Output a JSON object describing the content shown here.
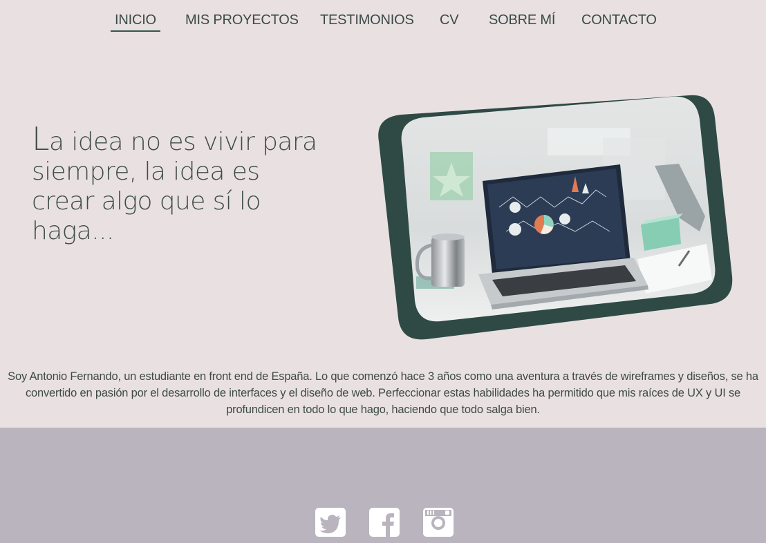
{
  "nav": {
    "items": [
      {
        "label": "INICIO",
        "active": true
      },
      {
        "label": "MIS PROYECTOS"
      },
      {
        "label": "TESTIMONIOS"
      },
      {
        "label": "CV"
      },
      {
        "label": "SOBRE MÍ"
      },
      {
        "label": "CONTACTO"
      }
    ]
  },
  "hero": {
    "quote_first": "L",
    "quote_rest": "a idea no es vivir para siempre, la idea es crear algo que sí lo haga..."
  },
  "bio": {
    "text": "Soy Antonio Fernando, un estudiante en front end de España. Lo que comenzó hace 3 años como una aventura a través de wireframes y diseños, se ha convertido en pasión por el desarrollo de interfaces y el diseño de web. Perfeccionar estas habilidades ha permitido que mis raíces de UX y UI se profundicen en todo lo que hago, haciendo que todo salga bien."
  },
  "footer": {
    "social": [
      {
        "icon": "twitter-icon"
      },
      {
        "icon": "facebook-icon"
      },
      {
        "icon": "instagram-icon"
      }
    ]
  },
  "colors": {
    "background": "#e9e0e2",
    "frame": "#2f4a44",
    "footer": "#b9b4bd",
    "text": "#3b4a45"
  }
}
